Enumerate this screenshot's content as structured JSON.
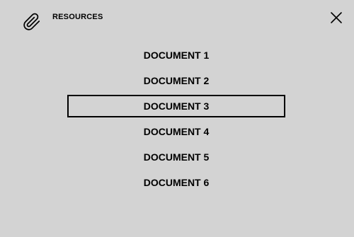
{
  "header": {
    "title": "RESOURCES",
    "icon": "paperclip-icon",
    "close_icon": "close-icon"
  },
  "documents": {
    "selected_index": 2,
    "items": [
      {
        "label": "DOCUMENT 1"
      },
      {
        "label": "DOCUMENT 2"
      },
      {
        "label": "DOCUMENT 3"
      },
      {
        "label": "DOCUMENT 4"
      },
      {
        "label": "DOCUMENT 5"
      },
      {
        "label": "DOCUMENT 6"
      }
    ]
  },
  "colors": {
    "background": "#d3d3d3",
    "text": "#000000",
    "selected_border": "#000000"
  }
}
